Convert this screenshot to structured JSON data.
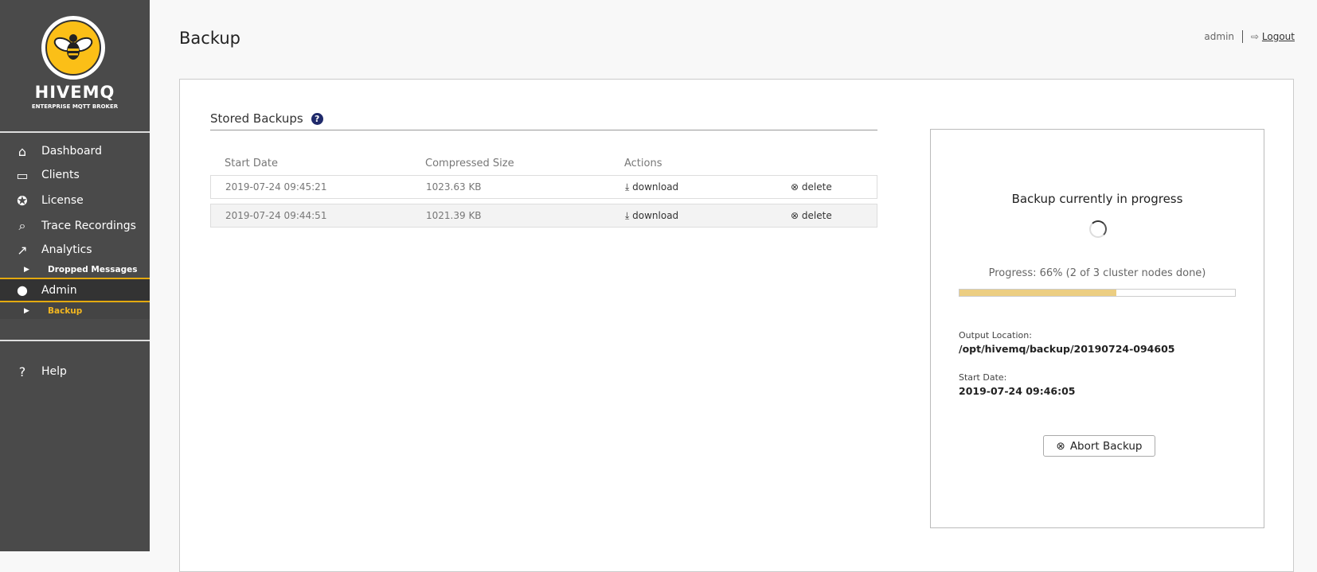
{
  "brand": {
    "name": "HIVEMQ",
    "subtitle": "ENTERPRISE MQTT BROKER"
  },
  "sidebar": {
    "items": [
      {
        "label": "Dashboard",
        "icon": "home-icon"
      },
      {
        "label": "Clients",
        "icon": "devices-icon"
      },
      {
        "label": "License",
        "icon": "award-icon"
      },
      {
        "label": "Trace Recordings",
        "icon": "trace-icon"
      },
      {
        "label": "Analytics",
        "icon": "chart-icon"
      },
      {
        "label": "Dropped Messages",
        "icon": "caret-right-icon"
      },
      {
        "label": "Admin",
        "icon": "user-icon"
      },
      {
        "label": "Backup",
        "icon": "caret-right-icon"
      },
      {
        "label": "Help",
        "icon": "question-icon"
      }
    ],
    "active_color": "#e4a90f"
  },
  "header": {
    "title": "Backup",
    "user": "admin",
    "logout": "Logout"
  },
  "stored": {
    "title": "Stored Backups",
    "columns": [
      "Start Date",
      "Compressed Size",
      "Actions"
    ],
    "rows": [
      {
        "date": "2019-07-24 09:45:21",
        "size": "1023.63 KB",
        "download": "download",
        "delete": "delete"
      },
      {
        "date": "2019-07-24 09:44:51",
        "size": "1021.39 KB",
        "download": "download",
        "delete": "delete"
      }
    ]
  },
  "progress": {
    "title": "Backup currently in progress",
    "text": "Progress: 66% (2 of 3 cluster nodes done)",
    "bar_fill_percent": 57,
    "bar_color": "#ecce82",
    "output_label": "Output Location:",
    "output_value": "/opt/hivemq/backup/20190724-094605",
    "start_label": "Start Date:",
    "start_value": "2019-07-24 09:46:05",
    "abort": "Abort Backup"
  }
}
